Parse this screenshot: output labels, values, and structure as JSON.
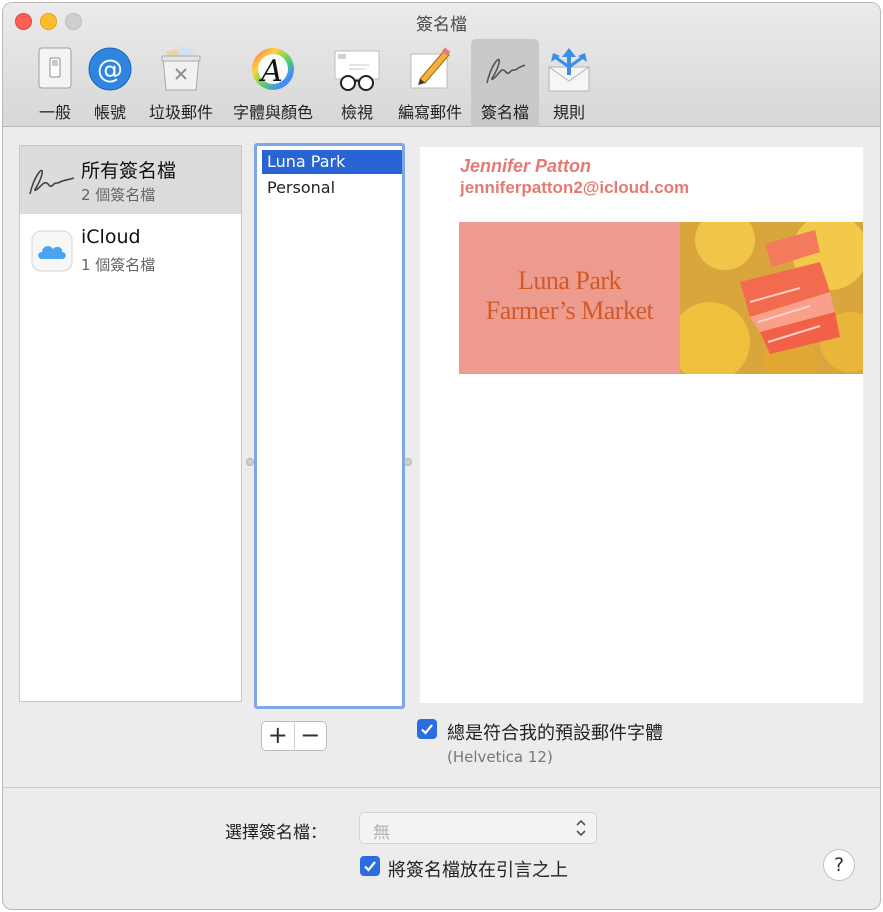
{
  "window": {
    "title": "簽名檔"
  },
  "toolbar": {
    "items": [
      {
        "label": "一般",
        "icon": "switch-icon"
      },
      {
        "label": "帳號",
        "icon": "at-sign-icon"
      },
      {
        "label": "垃圾郵件",
        "icon": "junk-trash-icon"
      },
      {
        "label": "字體與顏色",
        "icon": "fonts-colors-icon"
      },
      {
        "label": "檢視",
        "icon": "glasses-envelope-icon"
      },
      {
        "label": "編寫郵件",
        "icon": "pencil-paper-icon"
      },
      {
        "label": "簽名檔",
        "icon": "signature-icon",
        "selected": true
      },
      {
        "label": "規則",
        "icon": "rules-envelope-icon"
      }
    ]
  },
  "accounts": [
    {
      "name": "所有簽名檔",
      "count": "2 個簽名檔",
      "icon": "signature-icon",
      "selected": true
    },
    {
      "name": "iCloud",
      "count": "1 個簽名檔",
      "icon": "icloud-icon",
      "selected": false
    }
  ],
  "signatures": [
    {
      "name": "Luna Park",
      "selected": true
    },
    {
      "name": "Personal",
      "selected": false
    }
  ],
  "preview": {
    "name": "Jennifer Patton",
    "email": "jenniferpatton2@icloud.com",
    "banner_line1": "Luna Park",
    "banner_line2": "Farmer’s Market",
    "accent_color": "#e57a72"
  },
  "controls": {
    "add_label": "+",
    "remove_label": "−",
    "match_font_label": "總是符合我的預設郵件字體",
    "match_font_checked": true,
    "font_hint": "(Helvetica 12)",
    "choose_label": "選擇簽名檔：",
    "choose_value": "無",
    "above_quote_label": "將簽名檔放在引言之上",
    "above_quote_checked": true,
    "help_label": "?"
  }
}
